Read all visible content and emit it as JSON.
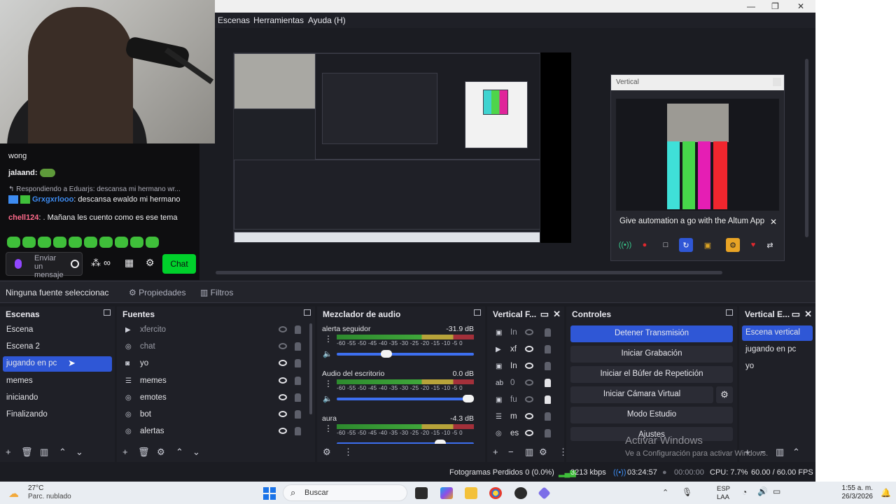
{
  "menubar": {
    "items": [
      "Escenas",
      "Herramientas",
      "Ayuda (H)"
    ]
  },
  "chat": {
    "messages": [
      {
        "user": "",
        "text": "wong",
        "user_color": "#efeff1"
      },
      {
        "user": "jalaand:",
        "text": "",
        "user_color": "#efeff1"
      },
      {
        "user": "",
        "text": "Respondiendo a Eduarjs: descansa mi hermano wr...",
        "user_color": "#adadb8"
      },
      {
        "user": "Grxgxrlooo",
        "text": ": descansa ewaldo mi hermano",
        "user_color": "#3d8bf0"
      },
      {
        "user": "chell124",
        "text": ": . Mañana les cuento como es ese tema",
        "user_color": "#ff6b8b"
      }
    ],
    "input_placeholder": "Enviar un mensaje",
    "chat_button": "Chat",
    "accent_color": "#00d12b"
  },
  "vertical_dock": {
    "title": "Vertical",
    "promo": "Give automation a go with the Altum App"
  },
  "source_toolbar": {
    "no_source": "Ninguna fuente seleccionac",
    "properties": "Propiedades",
    "filters": "Filtros"
  },
  "scenes": {
    "title": "Escenas",
    "items": [
      "Escena",
      "Escena 2",
      "jugando en pc",
      "memes",
      "iniciando",
      "Finalizando"
    ],
    "selected_index": 2
  },
  "sources": {
    "title": "Fuentes",
    "items": [
      {
        "name": "xfercito",
        "icon": "play-icon",
        "visible": false,
        "locked": true
      },
      {
        "name": "chat",
        "icon": "browser-icon",
        "visible": false,
        "locked": true
      },
      {
        "name": "yo",
        "icon": "camera-icon",
        "visible": true,
        "locked": true
      },
      {
        "name": "memes",
        "icon": "list-icon",
        "visible": true,
        "locked": true
      },
      {
        "name": "emotes",
        "icon": "browser-icon",
        "visible": true,
        "locked": true
      },
      {
        "name": "bot",
        "icon": "browser-icon",
        "visible": true,
        "locked": true
      },
      {
        "name": "alertas",
        "icon": "browser-icon",
        "visible": true,
        "locked": true
      }
    ]
  },
  "audio_mixer": {
    "title": "Mezclador de audio",
    "scale": "-60 -55 -50 -45 -40 -35 -30 -25 -20 -15 -10 -5 0",
    "channels": [
      {
        "name": "alerta seguidor",
        "db": "-31.9 dB",
        "volume": 0.35
      },
      {
        "name": "Audio del escritorio",
        "db": "0.0 dB",
        "volume": 1.0
      },
      {
        "name": "aura",
        "db": "-4.3 dB",
        "volume": 0.78
      }
    ]
  },
  "vertical_sources": {
    "title": "Vertical F...",
    "items": [
      "In",
      "xf",
      "In",
      "0",
      "fu",
      "m",
      "es"
    ]
  },
  "controls": {
    "title": "Controles",
    "buttons": [
      "Detener Transmisión",
      "Iniciar Grabación",
      "Iniciar el Búfer de Repetición",
      "Iniciar Cámara Virtual",
      "Modo Estudio",
      "Ajustes"
    ]
  },
  "vertical_scenes": {
    "title": "Vertical E...",
    "items": [
      "Escena vertical",
      "jugando en pc",
      "yo"
    ],
    "selected_index": 0
  },
  "watermark": {
    "line1": "Activar Windows",
    "line2": "Ve a Configuración para activar Windows."
  },
  "status": {
    "dropped": "Fotogramas Perdidos 0 (0.0%)",
    "bitrate": "3213 kbps",
    "live_time": "03:24:57",
    "rec_time": "00:00:00",
    "cpu": "CPU: 7.7%",
    "fps": "60.00 / 60.00 FPS"
  },
  "taskbar": {
    "weather_temp": "27°C",
    "weather_desc": "Parc. nublado",
    "search": "Buscar",
    "lang1": "ESP",
    "lang2": "LAA",
    "time": "1:55 a. m.",
    "date": "26/3/2026"
  }
}
